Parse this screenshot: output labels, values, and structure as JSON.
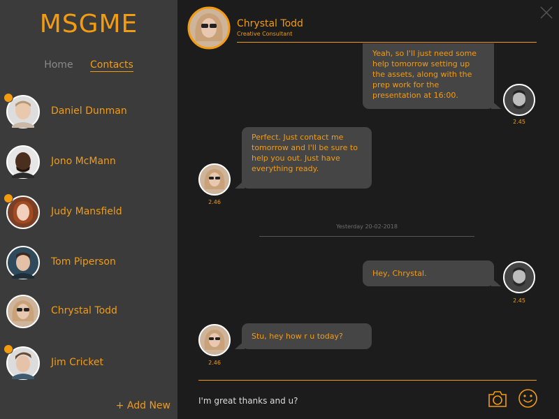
{
  "app": {
    "brand": "MSGME"
  },
  "nav": {
    "home": "Home",
    "contacts": "Contacts"
  },
  "contacts": [
    {
      "name": "Daniel Dunman",
      "unread": true,
      "avatar": "man-short-hair-avatar"
    },
    {
      "name": "Jono McMann",
      "unread": false,
      "avatar": "man-dark-skin-avatar"
    },
    {
      "name": "Judy Mansfield",
      "unread": true,
      "avatar": "woman-red-hair-avatar"
    },
    {
      "name": "Tom Piperson",
      "unread": false,
      "avatar": "man-dark-hair-avatar"
    },
    {
      "name": "Chrystal Todd",
      "unread": false,
      "avatar": "woman-sunglasses-avatar"
    },
    {
      "name": "Jim Cricket",
      "unread": true,
      "avatar": "man-brown-hair-avatar"
    }
  ],
  "sidebar": {
    "add_new": "+ Add New"
  },
  "chat": {
    "name": "Chrystal Todd",
    "role": "Creative Consultant",
    "messages": [
      {
        "from": "me",
        "text": "Yeah, so I'll just need some help tomorrow setting up the assets, along with the prep work for the presentation at 16:00.",
        "time": "2.45"
      },
      {
        "from": "them",
        "text": "Perfect.  Just contact me tomorrow and I'll be sure to help you out.  Just have everything ready.",
        "time": "2.46"
      },
      {
        "from": "me",
        "text": "Hey, Chrystal.",
        "time": "2.45"
      },
      {
        "from": "them",
        "text": "Stu, hey how r u today?",
        "time": "2.46"
      }
    ],
    "date_separator": "Yesterday 20-02-2018"
  },
  "compose": {
    "value": "I'm great thanks and u?"
  },
  "icons": {
    "close": "close-icon",
    "camera": "camera-icon",
    "emoji": "smiley-icon"
  },
  "colors": {
    "accent": "#f39c12",
    "sidebar": "#3b3b3b",
    "main": "#1c1c1c",
    "bubble": "#454545"
  }
}
